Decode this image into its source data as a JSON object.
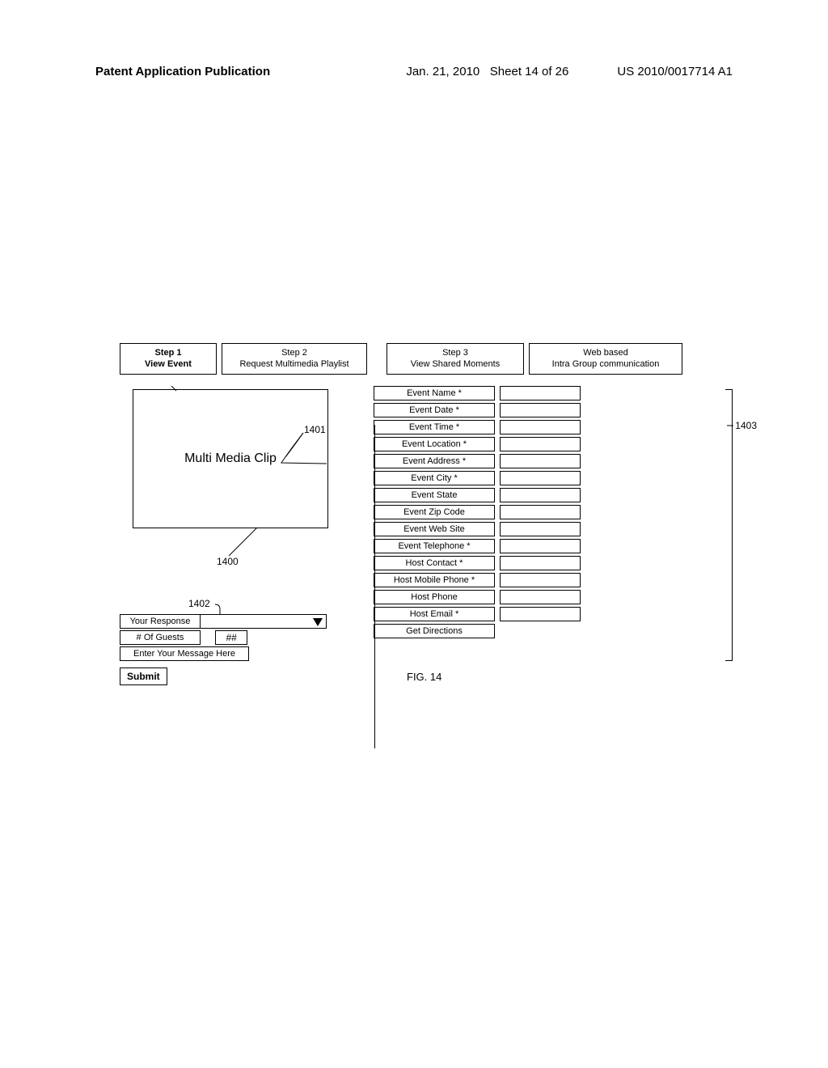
{
  "header": {
    "left": "Patent Application Publication",
    "date": "Jan. 21, 2010",
    "sheet": "Sheet 14 of 26",
    "pubnum": "US 2010/0017714 A1"
  },
  "tabs": {
    "t1_line1": "Step 1",
    "t1_line2": "View Event",
    "t2_line1": "Step 2",
    "t2_line2": "Request Multimedia Playlist",
    "t3_line1": "Step 3",
    "t3_line2": "View Shared Moments",
    "t4_line1": "Web based",
    "t4_line2": "Intra Group communication"
  },
  "media_label": "Multi Media Clip",
  "callouts": {
    "c1400": "1400",
    "c1401": "1401",
    "c1402": "1402",
    "c1403": "1403"
  },
  "response": {
    "your_response": "Your Response",
    "num_guests": "# Of Guests",
    "num_guests_val": "##",
    "message_placeholder": "Enter Your Message Here",
    "submit": "Submit"
  },
  "fields": [
    "Event Name *",
    "Event Date *",
    "Event Time *",
    "Event Location *",
    "Event Address *",
    "Event City *",
    "Event State",
    "Event Zip Code",
    "Event Web Site",
    "Event Telephone *",
    "Host Contact *",
    "Host Mobile Phone *",
    "Host Phone",
    "Host Email *",
    "Get Directions"
  ],
  "fig_caption": "FIG. 14"
}
